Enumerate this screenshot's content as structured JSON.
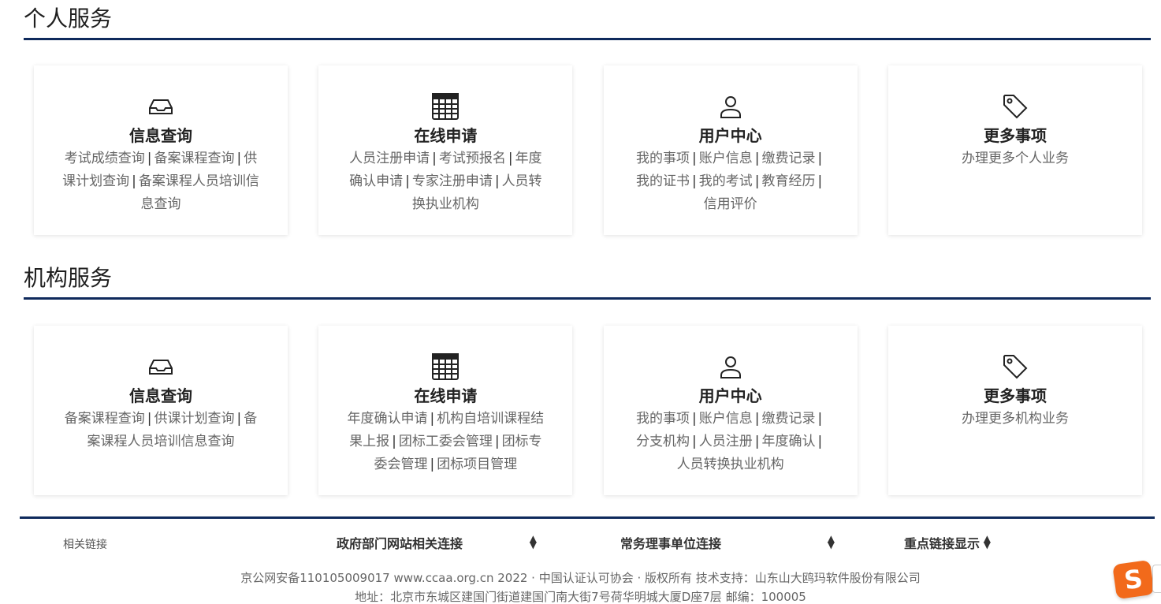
{
  "personal": {
    "title": "个人服务",
    "cards": [
      {
        "title": "信息查询",
        "icon": "inbox-icon",
        "links": [
          "考试成绩查询",
          "备案课程查询",
          "供课计划查询",
          "备案课程人员培训信息查询"
        ]
      },
      {
        "title": "在线申请",
        "icon": "table-icon",
        "links": [
          "人员注册申请",
          "考试预报名",
          "年度确认申请",
          "专家注册申请",
          "人员转换执业机构"
        ]
      },
      {
        "title": "用户中心",
        "icon": "user-icon",
        "links": [
          "我的事项",
          "账户信息",
          "缴费记录",
          "我的证书",
          "我的考试",
          "教育经历",
          "信用评价"
        ]
      },
      {
        "title": "更多事项",
        "icon": "tag-icon",
        "links": [
          "办理更多个人业务"
        ]
      }
    ]
  },
  "org": {
    "title": "机构服务",
    "cards": [
      {
        "title": "信息查询",
        "icon": "inbox-icon",
        "links": [
          "备案课程查询",
          "供课计划查询",
          "备案课程人员培训信息查询"
        ]
      },
      {
        "title": "在线申请",
        "icon": "table-icon",
        "links": [
          "年度确认申请",
          "机构自培训课程结果上报",
          "团标工委会管理",
          "团标专委会管理",
          "团标项目管理"
        ]
      },
      {
        "title": "用户中心",
        "icon": "user-icon",
        "links": [
          "我的事项",
          "账户信息",
          "缴费记录",
          "分支机构",
          "人员注册",
          "年度确认",
          "人员转换执业机构"
        ]
      },
      {
        "title": "更多事项",
        "icon": "tag-icon",
        "links": [
          "办理更多机构业务"
        ]
      }
    ]
  },
  "footer": {
    "related_label": "相关链接",
    "selects": [
      "政府部门网站相关连接",
      "常务理事单位连接",
      "重点链接显示"
    ],
    "copyright_line1": "京公网安备110105009017 www.ccaa.org.cn 2022 · 中国认证认可协会 · 版权所有 技术支持：山东山大鸥玛软件股份有限公司",
    "copyright_line2": "地址：北京市东城区建国门街道建国门南大街7号荷华明城大厦D座7层 邮编：100005"
  },
  "float_logo": {
    "text": "S",
    "icon": "sogou-input-icon",
    "color": "#f26a1b"
  },
  "colors": {
    "accent_rule": "#0f2a5c"
  }
}
